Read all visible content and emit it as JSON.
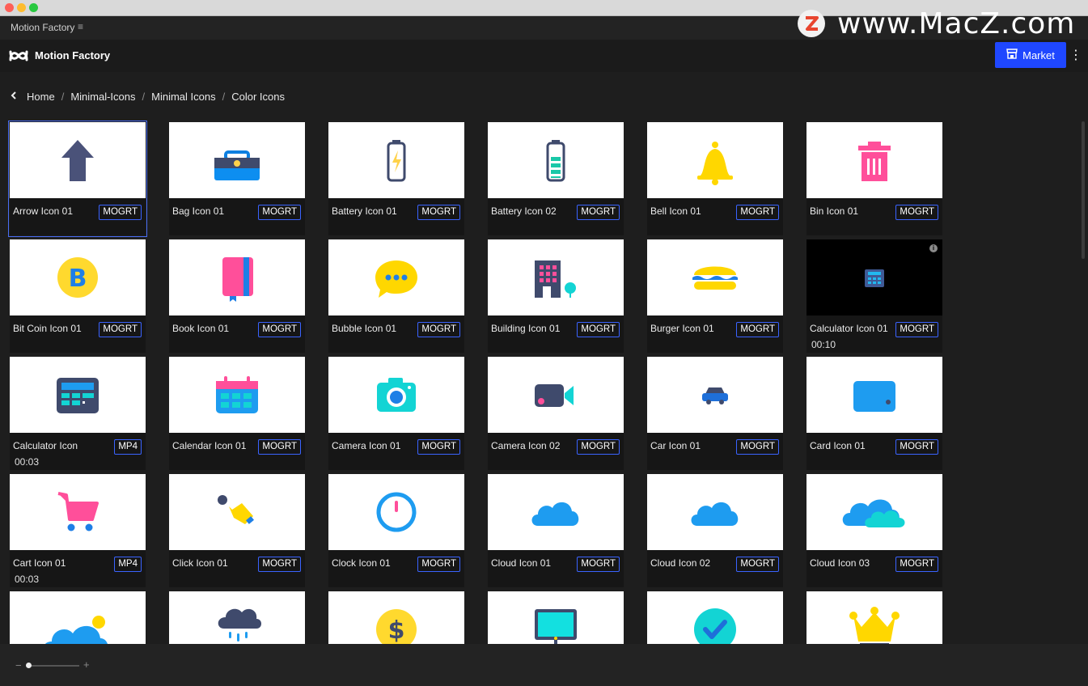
{
  "window": {
    "panel_title": "Motion Factory",
    "menu_glyph": "≡"
  },
  "watermark": {
    "text": "www.MacZ.com",
    "badge": "Z"
  },
  "header": {
    "app_name": "Motion Factory",
    "market_label": "Market",
    "more_glyph": "⋮"
  },
  "breadcrumb": {
    "back_glyph": "‹",
    "items": [
      "Home",
      "Minimal-Icons",
      "Minimal Icons",
      "Color Icons"
    ]
  },
  "colors": {
    "accent": "#1f47ff",
    "badge_border": "#3a63ff",
    "selected_outline": "#4a6ef5"
  },
  "items": [
    {
      "name": "Arrow Icon 01",
      "badge": "MOGRT",
      "icon": "arrow-up-icon",
      "selected": true
    },
    {
      "name": "Bag Icon 01",
      "badge": "MOGRT",
      "icon": "briefcase-icon"
    },
    {
      "name": "Battery Icon 01",
      "badge": "MOGRT",
      "icon": "battery-charging-icon"
    },
    {
      "name": "Battery Icon 02",
      "badge": "MOGRT",
      "icon": "battery-full-icon"
    },
    {
      "name": "Bell Icon 01",
      "badge": "MOGRT",
      "icon": "bell-icon"
    },
    {
      "name": "Bin Icon 01",
      "badge": "MOGRT",
      "icon": "trash-bin-icon"
    },
    {
      "name": "Bit Coin Icon 01",
      "badge": "MOGRT",
      "icon": "bitcoin-icon"
    },
    {
      "name": "Book Icon 01",
      "badge": "MOGRT",
      "icon": "book-icon"
    },
    {
      "name": "Bubble Icon 01",
      "badge": "MOGRT",
      "icon": "chat-bubble-icon"
    },
    {
      "name": "Building Icon 01",
      "badge": "MOGRT",
      "icon": "building-icon"
    },
    {
      "name": "Burger Icon 01",
      "badge": "MOGRT",
      "icon": "burger-icon"
    },
    {
      "name": "Calculator Icon 01",
      "badge": "MOGRT",
      "icon": "calculator-small-icon",
      "duration": "00:10",
      "dark": true,
      "info": true
    },
    {
      "name": "Calculator Icon",
      "badge": "MP4",
      "icon": "calculator-icon",
      "duration": "00:03"
    },
    {
      "name": "Calendar Icon 01",
      "badge": "MOGRT",
      "icon": "calendar-icon"
    },
    {
      "name": "Camera Icon 01",
      "badge": "MOGRT",
      "icon": "camera-icon"
    },
    {
      "name": "Camera Icon 02",
      "badge": "MOGRT",
      "icon": "video-camera-icon"
    },
    {
      "name": "Car Icon 01",
      "badge": "MOGRT",
      "icon": "car-icon"
    },
    {
      "name": "Card Icon 01",
      "badge": "MOGRT",
      "icon": "credit-card-icon"
    },
    {
      "name": "Cart Icon 01",
      "badge": "MP4",
      "icon": "shopping-cart-icon",
      "duration": "00:03"
    },
    {
      "name": "Click Icon 01",
      "badge": "MOGRT",
      "icon": "click-hand-icon"
    },
    {
      "name": "Clock Icon 01",
      "badge": "MOGRT",
      "icon": "clock-icon"
    },
    {
      "name": "Cloud Icon 01",
      "badge": "MOGRT",
      "icon": "cloud-icon"
    },
    {
      "name": "Cloud Icon 02",
      "badge": "MOGRT",
      "icon": "cloud-icon"
    },
    {
      "name": "Cloud Icon 03",
      "badge": "MOGRT",
      "icon": "double-cloud-icon"
    },
    {
      "name": "",
      "badge": "",
      "icon": "cloud-sun-icon"
    },
    {
      "name": "",
      "badge": "",
      "icon": "cloud-rain-icon"
    },
    {
      "name": "",
      "badge": "",
      "icon": "dollar-coin-icon"
    },
    {
      "name": "",
      "badge": "",
      "icon": "monitor-icon"
    },
    {
      "name": "",
      "badge": "",
      "icon": "check-circle-icon"
    },
    {
      "name": "",
      "badge": "",
      "icon": "crown-icon"
    }
  ],
  "footer": {
    "zoom_minus": "−",
    "zoom_plus": "+"
  }
}
